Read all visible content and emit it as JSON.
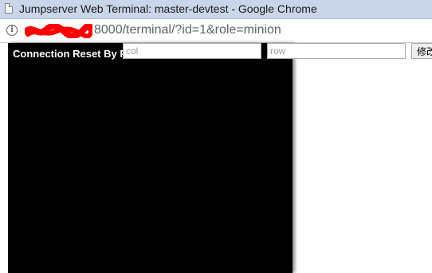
{
  "window": {
    "title": "Jumpserver Web Terminal: master-devtest - Google Chrome"
  },
  "addressbar": {
    "url_visible": "8000/terminal/?id=1&role=minion"
  },
  "terminal": {
    "output_text": "Connection Reset By Pe"
  },
  "resize_form": {
    "col_placeholder": "col",
    "row_placeholder": "row",
    "button_label": "修改"
  },
  "colors": {
    "titlebar": "#c9d6e9",
    "terminal_bg": "#000000",
    "redaction": "#ff0000"
  }
}
